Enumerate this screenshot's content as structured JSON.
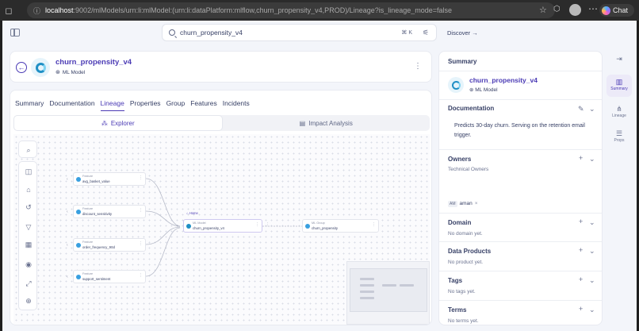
{
  "browser": {
    "url_host": "localhost",
    "url_rest": ":9002/mlModels/urn:li:mlModel:(urn:li:dataPlatform:mlflow,churn_propensity_v4,PROD)/Lineage?is_lineage_mode=false",
    "chat_label": "Chat"
  },
  "topbar": {
    "search_value": "churn_propensity_v4",
    "search_shortcut": "⌘ K",
    "discover_label": "Discover →"
  },
  "entity": {
    "name": "churn_propensity_v4",
    "type": "ML Model"
  },
  "tabs": [
    "Summary",
    "Documentation",
    "Lineage",
    "Properties",
    "Group",
    "Features",
    "Incidents"
  ],
  "active_tab": "Lineage",
  "lineage_modes": {
    "explorer": "Explorer",
    "impact": "Impact Analysis"
  },
  "graph": {
    "inputs": [
      {
        "type": "Feature",
        "name": "avg_basket_value"
      },
      {
        "type": "Feature",
        "name": "discount_sensitivity"
      },
      {
        "type": "Feature",
        "name": "order_frequency_90d"
      },
      {
        "type": "Feature",
        "name": "support_sentiment"
      }
    ],
    "home_label": "Home",
    "center": {
      "type": "ML Model",
      "name": "churn_propensity_v4"
    },
    "output": {
      "type": "ML Group",
      "name": "churn_propensity"
    }
  },
  "sidebar": {
    "title": "Summary",
    "entity_name": "churn_propensity_v4",
    "entity_type": "ML Model",
    "documentation_title": "Documentation",
    "documentation_text": "Predicts 30-day churn. Serving on the retention email trigger.",
    "owners_title": "Owners",
    "owners_sub": "Technical Owners",
    "owner_initials": "AM",
    "owner_name": "aman",
    "domain_title": "Domain",
    "domain_empty": "No domain yet.",
    "data_products_title": "Data Products",
    "data_products_empty": "No product yet.",
    "tags_title": "Tags",
    "tags_empty": "No tags yet.",
    "terms_title": "Terms",
    "terms_empty": "No terms yet."
  },
  "rail": {
    "summary": "Summary",
    "lineage": "Lineage",
    "props": "Props"
  },
  "colors": {
    "accent": "#4b3bb5",
    "model_icon": "#1f8fc5",
    "feature_dot": "#39a0e0"
  }
}
